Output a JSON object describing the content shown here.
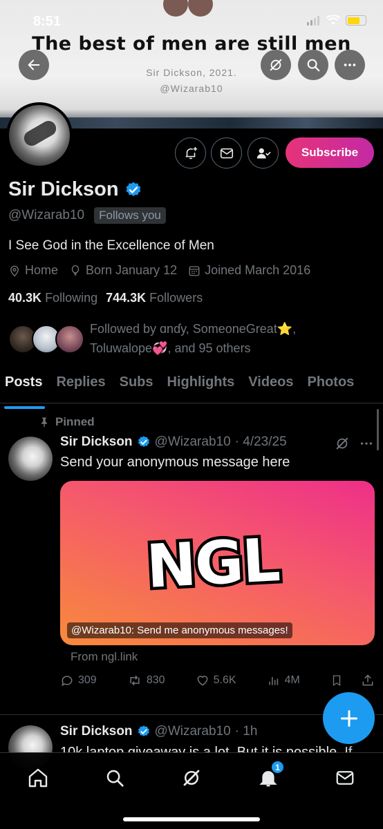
{
  "status_bar": {
    "time": "8:51"
  },
  "banner": {
    "quote": "The best of men are still men",
    "credit_line1": "Sir Dickson, 2021.",
    "credit_line2": "@Wizarab10"
  },
  "header_buttons": [
    "back-arrow-icon",
    "grok-icon",
    "search-icon",
    "more-icon"
  ],
  "profile": {
    "name": "Sir Dickson",
    "handle": "@Wizarab10",
    "follows_you": "Follows you",
    "bio": "I See God in the Excellence of Men",
    "location": "Home",
    "born": "Born January 12",
    "joined": "Joined March 2016",
    "following_count": "40.3K",
    "following_label": "Following",
    "followers_count": "744.3K",
    "followers_label": "Followers",
    "followed_by_line1": "Followed by ɑnɗy, SomeoneGreat⭐,",
    "followed_by_line2": "Toluwalope💞, and 95 others",
    "subscribe_label": "Subscribe",
    "verified_color": "#1d9bf0"
  },
  "tabs": [
    "Posts",
    "Replies",
    "Subs",
    "Highlights",
    "Videos",
    "Photos"
  ],
  "active_tab": "Posts",
  "posts": [
    {
      "pinned_label": "Pinned",
      "author": "Sir Dickson",
      "handle": "@Wizarab10",
      "date": "· 4/23/25",
      "text": "Send your anonymous message here",
      "card_logo": "NGL",
      "card_caption": "@Wizarab10: Send me anonymous messages!",
      "card_source": "From ngl.link",
      "replies": "309",
      "reposts": "830",
      "likes": "5.6K",
      "views": "4M"
    },
    {
      "author": "Sir Dickson",
      "handle": "@Wizarab10",
      "date": "· 1h",
      "text": "10k laptop giveaway is a lot. But it is possible. If"
    }
  ],
  "bottom_nav": {
    "items": [
      "home-icon",
      "search-icon",
      "grok-icon",
      "notifications-icon",
      "messages-icon"
    ],
    "notification_badge": "1"
  },
  "colors": {
    "accent": "#1d9bf0",
    "subscribe_start": "#e6337a",
    "subscribe_end": "#c32aa3"
  }
}
